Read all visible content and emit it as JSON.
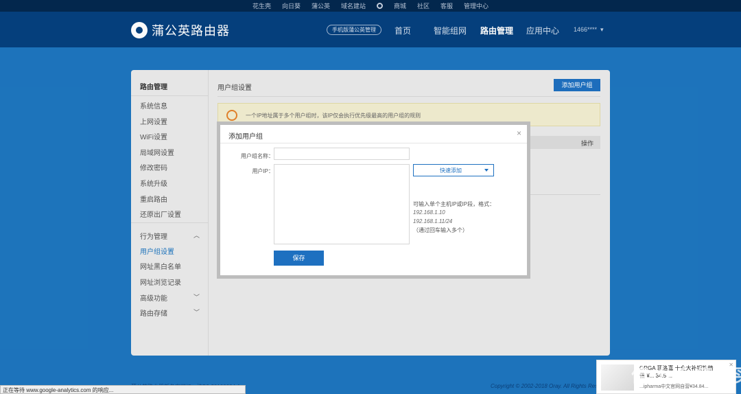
{
  "topbar": {
    "links": [
      "花生壳",
      "向日葵",
      "蒲公英",
      "域名建站",
      "商城",
      "社区",
      "客服",
      "管理中心"
    ]
  },
  "header": {
    "logo_text": "蒲公英路由器",
    "mobile_button": "手机版蒲公英管理",
    "nav": [
      "首页",
      "智能组网",
      "路由管理",
      "应用中心"
    ],
    "user": "1466****"
  },
  "sidebar": {
    "title": "路由管理",
    "items": [
      "系统信息",
      "上网设置",
      "WiFi设置",
      "局域网设置",
      "修改密码",
      "系统升级",
      "重启路由",
      "还原出厂设置"
    ],
    "behavior": "行为管理",
    "behavior_items": [
      "用户组设置",
      "网址黑白名单",
      "网址浏览记录"
    ],
    "advanced": "高级功能",
    "storage": "路由存储"
  },
  "content": {
    "title": "用户组设置",
    "add_button": "添加用户组",
    "tip": "一个IP地址属于多个用户组时，该IP仅会执行优先级最高的用户组的规则",
    "col_action": "操作"
  },
  "dialog": {
    "title": "添加用户组",
    "close": "×",
    "name_label": "用户组名称：",
    "name_value": "",
    "ip_label": "用户IP：",
    "ip_value": "",
    "quick_add": "快速添加",
    "hint_1": "可输入单个主机IP或IP段，格式：",
    "hint_2": "192.168.1.10",
    "hint_3": "192.168.1.11/24",
    "hint_4": "（通过回车输入多个）",
    "save": "保存"
  },
  "footer": {
    "left": "蒲公英路由器新备案可证：沪B2-20100004-1",
    "right": "Copyright © 2002-2018 Oray. All Rights Reserved",
    "status": "正在等待 www.google-analytics.com 的响应..."
  },
  "ad": {
    "line1": "ORGA 菲洛嘉 十全大补银钩精",
    "line2": "值 ¥...  34.5 ...",
    "line3": "...ipharma中文官网自营¥34.84...",
    "watermark": "值 什么值得买"
  },
  "colors": {
    "accent": "#1e70c0",
    "header_bg": "#06417f",
    "page_bg": "#1e76bf"
  }
}
